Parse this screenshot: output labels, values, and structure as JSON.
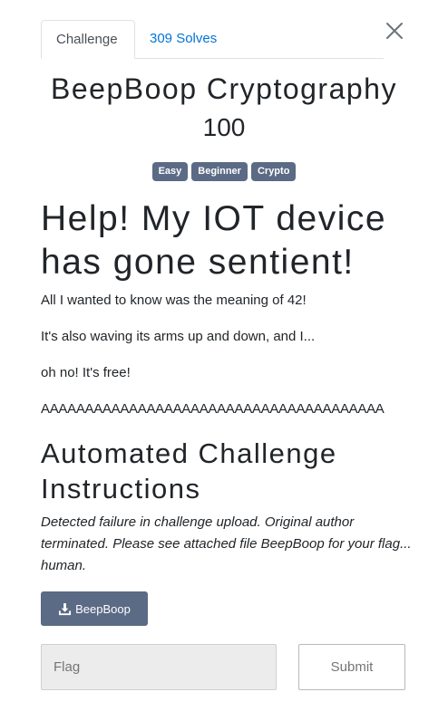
{
  "tabs": [
    {
      "label": "Challenge",
      "active": true
    },
    {
      "label": "309 Solves",
      "active": false
    }
  ],
  "close_icon": "close-icon",
  "challenge": {
    "name": "BeepBoop Cryptography",
    "value": "100",
    "tags": [
      "Easy",
      "Beginner",
      "Crypto"
    ]
  },
  "description": {
    "heading": "Help! My IOT device has gone sentient!",
    "paragraphs": [
      "All I wanted to know was the meaning of 42!",
      "It's also waving its arms up and down, and I...",
      "oh no! It's free!",
      "AAAAAAAAAAAAAAAAAAAAAAAAAAAAAAAAAAAAAAA"
    ],
    "instructions_heading": "Automated Challenge Instructions",
    "instructions_text": "Detected failure in challenge upload. Original author terminated. Please see attached file BeepBoop for your flag... human."
  },
  "file_button": {
    "label": "BeepBoop",
    "icon": "download-icon"
  },
  "flag_form": {
    "placeholder": "Flag",
    "value": "",
    "submit_label": "Submit"
  },
  "colors": {
    "tag_bg": "#5b6a85",
    "link": "#0275d8",
    "button_bg": "#5b6a85"
  }
}
